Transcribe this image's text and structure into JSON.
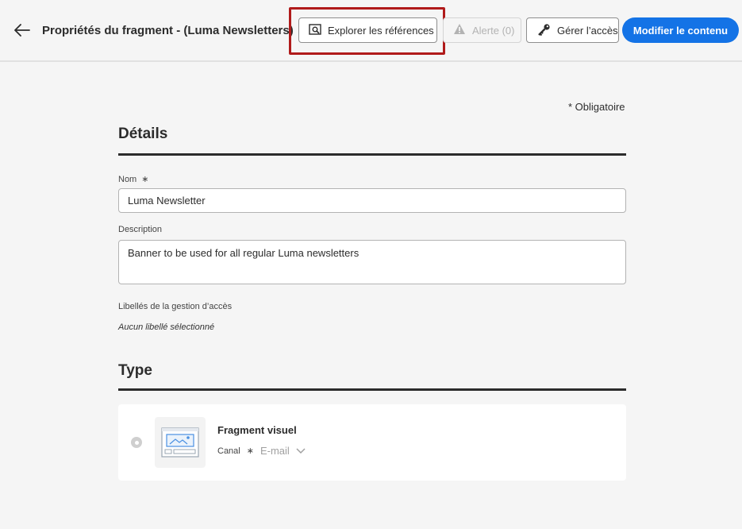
{
  "header": {
    "title": "Propriétés du fragment - (Luma Newsletters)",
    "explore_label": "Explorer les références",
    "alert_label": "Alerte (0)",
    "access_label": "Gérer l’accès",
    "edit_label": "Modifier le contenu"
  },
  "form": {
    "required_note": "* Obligatoire",
    "details_heading": "Détails",
    "name_label": "Nom",
    "name_required_mark": "∗",
    "name_value": "Luma Newsletter",
    "description_label": "Description",
    "description_value": "Banner to be used for all regular Luma newsletters",
    "access_labels_label": "Libellés de la gestion d’accès",
    "access_labels_value": "Aucun libellé sélectionné",
    "type_heading": "Type"
  },
  "type_card": {
    "title": "Fragment visuel",
    "channel_label": "Canal",
    "channel_required_mark": "∗",
    "channel_value": "E-mail"
  },
  "colors": {
    "primary": "#1473e6",
    "highlight": "#b01a1a"
  }
}
